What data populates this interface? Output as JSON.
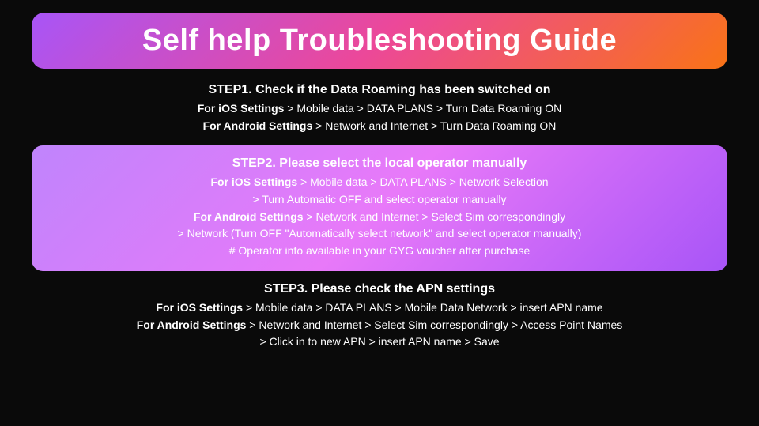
{
  "title": "Self help Troubleshooting Guide",
  "steps": [
    {
      "id": "step1",
      "title": "STEP1. Check if the Data Roaming has been switched on",
      "highlighted": false,
      "lines": [
        {
          "bold_part": "For iOS Settings",
          "rest": " > Mobile data > DATA PLANS > Turn Data Roaming ON"
        },
        {
          "bold_part": "For Android Settings",
          "rest": " > Network and Internet > Turn Data Roaming ON"
        }
      ]
    },
    {
      "id": "step2",
      "title": "STEP2. Please select the local operator manually",
      "highlighted": true,
      "lines": [
        {
          "bold_part": "For iOS Settings",
          "rest": " > Mobile data > DATA PLANS > Network Selection"
        },
        {
          "bold_part": "",
          "rest": "> Turn Automatic OFF and select operator manually"
        },
        {
          "bold_part": "For Android Settings",
          "rest": " > Network and Internet > Select Sim correspondingly"
        },
        {
          "bold_part": "",
          "rest": "> Network (Turn OFF \"Automatically select network\" and select operator manually)"
        },
        {
          "bold_part": "",
          "rest": "# Operator info available in your GYG voucher after purchase"
        }
      ]
    },
    {
      "id": "step3",
      "title": "STEP3. Please check the APN settings",
      "highlighted": false,
      "lines": [
        {
          "bold_part": "For iOS Settings",
          "rest": " > Mobile data > DATA PLANS > Mobile Data Network > insert APN name"
        },
        {
          "bold_part": "For Android Settings",
          "rest": " > Network and Internet > Select Sim correspondingly > Access Point Names"
        },
        {
          "bold_part": "",
          "rest": "> Click in to new APN > insert APN name > Save"
        }
      ]
    }
  ]
}
